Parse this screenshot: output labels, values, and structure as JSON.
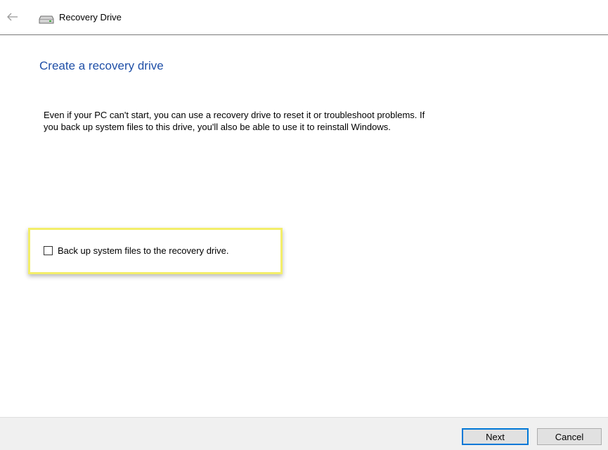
{
  "window": {
    "title": "Recovery Drive"
  },
  "icons": {
    "back": "back-arrow-icon",
    "drive": "drive-icon"
  },
  "main": {
    "heading": "Create a recovery drive",
    "description_line1": "Even if your PC can't start, you can use a recovery drive to reset it or troubleshoot problems. If",
    "description_line2": "you back up system files to this drive, you'll also be able to use it to reinstall Windows.",
    "checkbox": {
      "label": "Back up system files to the recovery drive.",
      "checked": false
    }
  },
  "footer": {
    "next_label": "Next",
    "cancel_label": "Cancel"
  },
  "colors": {
    "heading": "#1f4fa7",
    "highlight_border": "#f3ee6a",
    "footer_bg": "#f0f0f0",
    "default_button_border": "#0078d7"
  }
}
